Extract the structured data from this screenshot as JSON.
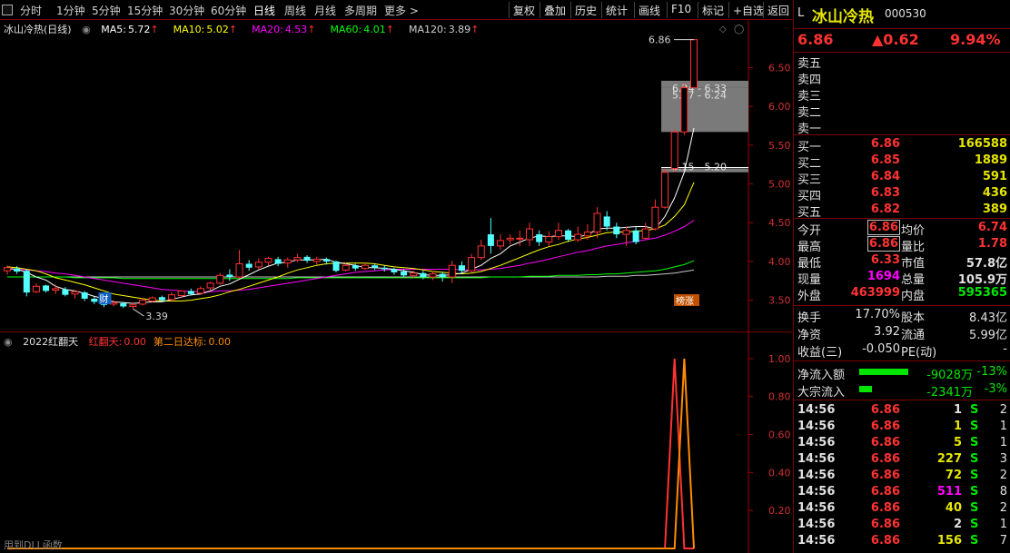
{
  "toolbar": {
    "periods": [
      "分时",
      "1分钟",
      "5分钟",
      "15分钟",
      "30分钟",
      "60分钟",
      "日线",
      "周线",
      "月线",
      "多周期",
      "更多 >"
    ],
    "active_period": "日线",
    "buttons": [
      "复权",
      "叠加",
      "历史",
      "统计",
      "画线",
      "F10",
      "标记",
      "+自选",
      "返回"
    ]
  },
  "main_chart": {
    "title": "冰山冷热(日线)",
    "ma": [
      {
        "label": "MA5:",
        "value": "5.72",
        "color": "#ffffff"
      },
      {
        "label": "MA10:",
        "value": "5.02",
        "color": "#ffff00"
      },
      {
        "label": "MA20:",
        "value": "4.53",
        "color": "#ff00ff"
      },
      {
        "label": "MA60:",
        "value": "4.01",
        "color": "#00ff00"
      },
      {
        "label": "MA120:",
        "value": "3.89",
        "color": "#d0d0d0"
      }
    ],
    "price_axis": [
      "6.50",
      "6.00",
      "5.50",
      "5.00",
      "4.50",
      "4.00",
      "3.50"
    ],
    "high_label": "6.86",
    "low_label": "3.39",
    "gaps": [
      {
        "label": "6.24 - 6.33",
        "low": 6.24,
        "high": 6.33
      },
      {
        "label": "5.67 - 6.24",
        "low": 5.67,
        "high": 6.24
      },
      {
        "label": "5.15 - 5.20",
        "low": 5.15,
        "high": 5.2
      }
    ],
    "markers": {
      "cai": "财",
      "bang": "榜涨"
    },
    "chart_data": {
      "type": "candlestick",
      "ylim": [
        3.25,
        6.95
      ],
      "candles": [
        [
          3.88,
          3.92,
          3.83,
          3.95
        ],
        [
          3.91,
          3.87,
          3.84,
          3.94
        ],
        [
          3.88,
          3.6,
          3.55,
          3.9
        ],
        [
          3.61,
          3.68,
          3.59,
          3.72
        ],
        [
          3.69,
          3.62,
          3.6,
          3.7
        ],
        [
          3.63,
          3.65,
          3.58,
          3.7
        ],
        [
          3.64,
          3.57,
          3.55,
          3.67
        ],
        [
          3.58,
          3.61,
          3.52,
          3.63
        ],
        [
          3.6,
          3.52,
          3.49,
          3.62
        ],
        [
          3.52,
          3.48,
          3.45,
          3.54
        ],
        [
          3.47,
          3.44,
          3.41,
          3.5
        ],
        [
          3.45,
          3.47,
          3.42,
          3.5
        ],
        [
          3.46,
          3.42,
          3.4,
          3.48
        ],
        [
          3.42,
          3.44,
          3.39,
          3.47
        ],
        [
          3.45,
          3.5,
          3.43,
          3.53
        ],
        [
          3.49,
          3.53,
          3.47,
          3.55
        ],
        [
          3.54,
          3.5,
          3.48,
          3.56
        ],
        [
          3.51,
          3.57,
          3.49,
          3.6
        ],
        [
          3.56,
          3.62,
          3.53,
          3.63
        ],
        [
          3.62,
          3.58,
          3.56,
          3.65
        ],
        [
          3.59,
          3.65,
          3.57,
          3.68
        ],
        [
          3.66,
          3.72,
          3.62,
          3.74
        ],
        [
          3.72,
          3.82,
          3.7,
          3.85
        ],
        [
          3.83,
          3.8,
          3.75,
          3.9
        ],
        [
          3.8,
          3.97,
          3.78,
          4.15
        ],
        [
          3.97,
          3.92,
          3.88,
          4.02
        ],
        [
          3.93,
          3.99,
          3.9,
          4.04
        ],
        [
          3.99,
          4.04,
          3.95,
          4.06
        ],
        [
          4.03,
          3.97,
          3.94,
          4.06
        ],
        [
          3.98,
          4.02,
          3.92,
          4.05
        ],
        [
          4.02,
          4.05,
          3.99,
          4.1
        ],
        [
          4.06,
          4.01,
          3.98,
          4.08
        ],
        [
          4.0,
          4.03,
          3.96,
          4.06
        ],
        [
          4.03,
          4.0,
          3.96,
          4.05
        ],
        [
          4.0,
          3.88,
          3.86,
          4.01
        ],
        [
          3.89,
          3.95,
          3.87,
          3.98
        ],
        [
          3.95,
          3.91,
          3.88,
          3.97
        ],
        [
          3.91,
          3.95,
          3.89,
          3.98
        ],
        [
          3.95,
          3.92,
          3.89,
          3.97
        ],
        [
          3.92,
          3.9,
          3.87,
          3.95
        ],
        [
          3.9,
          3.86,
          3.83,
          3.92
        ],
        [
          3.87,
          3.82,
          3.8,
          3.9
        ],
        [
          3.82,
          3.85,
          3.79,
          3.88
        ],
        [
          3.85,
          3.8,
          3.77,
          3.88
        ],
        [
          3.8,
          3.84,
          3.76,
          3.88
        ],
        [
          3.84,
          3.8,
          3.74,
          3.87
        ],
        [
          3.8,
          3.95,
          3.72,
          4.01
        ],
        [
          3.95,
          3.88,
          3.84,
          4.0
        ],
        [
          3.88,
          4.05,
          3.86,
          4.1
        ],
        [
          4.05,
          4.2,
          4.02,
          4.28
        ],
        [
          4.35,
          4.2,
          4.1,
          4.56
        ],
        [
          4.2,
          4.27,
          4.15,
          4.35
        ],
        [
          4.28,
          4.3,
          4.22,
          4.35
        ],
        [
          4.3,
          4.3,
          4.2,
          4.4
        ],
        [
          4.28,
          4.42,
          4.2,
          4.5
        ],
        [
          4.35,
          4.25,
          4.2,
          4.4
        ],
        [
          4.25,
          4.32,
          4.2,
          4.39
        ],
        [
          4.32,
          4.4,
          4.28,
          4.5
        ],
        [
          4.4,
          4.28,
          4.25,
          4.42
        ],
        [
          4.28,
          4.35,
          4.25,
          4.45
        ],
        [
          4.33,
          4.38,
          4.28,
          4.48
        ],
        [
          4.38,
          4.62,
          4.3,
          4.7
        ],
        [
          4.58,
          4.45,
          4.4,
          4.65
        ],
        [
          4.45,
          4.35,
          4.3,
          4.5
        ],
        [
          4.35,
          4.4,
          4.2,
          4.45
        ],
        [
          4.4,
          4.25,
          4.22,
          4.45
        ],
        [
          4.3,
          4.42,
          4.28,
          4.5
        ],
        [
          4.42,
          4.7,
          4.4,
          4.8
        ],
        [
          4.7,
          5.15,
          4.68,
          5.2
        ],
        [
          5.2,
          5.67,
          5.15,
          5.7
        ],
        [
          5.67,
          6.24,
          5.63,
          6.3
        ],
        [
          6.24,
          6.86,
          6.24,
          6.86
        ]
      ],
      "ma5": [
        3.91,
        3.9,
        3.86,
        3.8,
        3.76,
        3.68,
        3.64,
        3.62,
        3.59,
        3.55,
        3.52,
        3.48,
        3.47,
        3.46,
        3.47,
        3.48,
        3.48,
        3.51,
        3.54,
        3.57,
        3.58,
        3.62,
        3.68,
        3.71,
        3.77,
        3.83,
        3.89,
        3.94,
        3.98,
        3.99,
        4.02,
        4.02,
        4.02,
        4.03,
        3.99,
        3.97,
        3.95,
        3.92,
        3.92,
        3.91,
        3.9,
        3.88,
        3.86,
        3.83,
        3.82,
        3.82,
        3.83,
        3.85,
        3.9,
        3.95,
        4.04,
        4.1,
        4.2,
        4.25,
        4.3,
        4.33,
        4.32,
        4.33,
        4.33,
        4.32,
        4.34,
        4.42,
        4.43,
        4.43,
        4.44,
        4.45,
        4.45,
        4.42,
        4.58,
        4.82,
        5.15,
        5.72
      ],
      "ma10": [
        3.93,
        3.92,
        3.9,
        3.88,
        3.84,
        3.79,
        3.76,
        3.73,
        3.7,
        3.66,
        3.62,
        3.58,
        3.56,
        3.54,
        3.52,
        3.5,
        3.49,
        3.49,
        3.49,
        3.5,
        3.52,
        3.54,
        3.57,
        3.61,
        3.64,
        3.68,
        3.72,
        3.76,
        3.8,
        3.85,
        3.89,
        3.92,
        3.95,
        3.97,
        3.98,
        3.98,
        3.98,
        3.98,
        3.97,
        3.95,
        3.93,
        3.92,
        3.91,
        3.89,
        3.87,
        3.86,
        3.85,
        3.84,
        3.85,
        3.87,
        3.91,
        3.95,
        4.0,
        4.05,
        4.1,
        4.15,
        4.19,
        4.22,
        4.26,
        4.29,
        4.31,
        4.34,
        4.37,
        4.38,
        4.38,
        4.39,
        4.4,
        4.42,
        4.47,
        4.58,
        4.73,
        5.02
      ],
      "ma20": [
        3.9,
        3.9,
        3.89,
        3.88,
        3.87,
        3.85,
        3.84,
        3.82,
        3.8,
        3.78,
        3.76,
        3.74,
        3.72,
        3.7,
        3.68,
        3.66,
        3.64,
        3.63,
        3.62,
        3.61,
        3.61,
        3.61,
        3.62,
        3.62,
        3.63,
        3.64,
        3.66,
        3.68,
        3.7,
        3.72,
        3.74,
        3.76,
        3.78,
        3.8,
        3.82,
        3.84,
        3.86,
        3.87,
        3.88,
        3.89,
        3.9,
        3.9,
        3.9,
        3.9,
        3.9,
        3.9,
        3.9,
        3.89,
        3.89,
        3.89,
        3.9,
        3.91,
        3.93,
        3.95,
        3.98,
        4.0,
        4.03,
        4.06,
        4.09,
        4.12,
        4.14,
        4.17,
        4.2,
        4.22,
        4.24,
        4.26,
        4.28,
        4.3,
        4.34,
        4.39,
        4.45,
        4.53
      ],
      "ma60": [
        3.8,
        3.8,
        3.8,
        3.8,
        3.8,
        3.8,
        3.8,
        3.79,
        3.79,
        3.79,
        3.79,
        3.79,
        3.78,
        3.78,
        3.78,
        3.78,
        3.78,
        3.78,
        3.78,
        3.78,
        3.78,
        3.78,
        3.78,
        3.78,
        3.78,
        3.78,
        3.78,
        3.78,
        3.78,
        3.78,
        3.79,
        3.79,
        3.79,
        3.79,
        3.79,
        3.79,
        3.79,
        3.79,
        3.79,
        3.79,
        3.79,
        3.79,
        3.79,
        3.79,
        3.79,
        3.79,
        3.79,
        3.79,
        3.79,
        3.79,
        3.8,
        3.8,
        3.8,
        3.8,
        3.81,
        3.81,
        3.81,
        3.82,
        3.82,
        3.82,
        3.83,
        3.83,
        3.84,
        3.84,
        3.85,
        3.86,
        3.87,
        3.88,
        3.9,
        3.93,
        3.96,
        4.01
      ],
      "ma120": [
        3.8,
        3.8,
        3.8,
        3.8,
        3.8,
        3.8,
        3.8,
        3.8,
        3.8,
        3.8,
        3.8,
        3.8,
        3.8,
        3.8,
        3.8,
        3.8,
        3.8,
        3.8,
        3.8,
        3.8,
        3.8,
        3.8,
        3.8,
        3.8,
        3.8,
        3.8,
        3.8,
        3.8,
        3.8,
        3.8,
        3.8,
        3.8,
        3.8,
        3.8,
        3.8,
        3.8,
        3.8,
        3.8,
        3.8,
        3.8,
        3.8,
        3.8,
        3.8,
        3.8,
        3.8,
        3.8,
        3.8,
        3.8,
        3.8,
        3.8,
        3.8,
        3.8,
        3.8,
        3.8,
        3.8,
        3.8,
        3.8,
        3.8,
        3.8,
        3.8,
        3.8,
        3.8,
        3.81,
        3.81,
        3.81,
        3.82,
        3.82,
        3.83,
        3.84,
        3.85,
        3.87,
        3.89
      ]
    }
  },
  "sub_chart": {
    "title": "2022红翻天",
    "series": [
      {
        "label": "红翻天:",
        "value": "0.00",
        "color": "#ff3232"
      },
      {
        "label": "第二日达标:",
        "value": "0.00",
        "color": "#ff8c00"
      }
    ],
    "y_axis": [
      "1.00",
      "0.80",
      "0.60",
      "0.40",
      "0.20"
    ],
    "footer": "用到DLL函数",
    "chart_data": {
      "type": "line",
      "ylim": [
        0,
        1.1
      ],
      "red_spike_index": 69,
      "orange_spike_index": 70
    }
  },
  "quote": {
    "prefix": "L",
    "name": "冰山冷热",
    "code": "000530",
    "price": "6.86",
    "change": "▲0.62",
    "pct": "9.94%",
    "sell": [
      {
        "label": "卖五",
        "price": "",
        "vol": ""
      },
      {
        "label": "卖四",
        "price": "",
        "vol": ""
      },
      {
        "label": "卖三",
        "price": "",
        "vol": ""
      },
      {
        "label": "卖二",
        "price": "",
        "vol": ""
      },
      {
        "label": "卖一",
        "price": "",
        "vol": ""
      }
    ],
    "buy": [
      {
        "label": "买一",
        "price": "6.86",
        "vol": "166588"
      },
      {
        "label": "买二",
        "price": "6.85",
        "vol": "1889"
      },
      {
        "label": "买三",
        "price": "6.84",
        "vol": "591"
      },
      {
        "label": "买四",
        "price": "6.83",
        "vol": "436"
      },
      {
        "label": "买五",
        "price": "6.82",
        "vol": "389"
      }
    ],
    "stats": [
      {
        "l1": "今开",
        "v1": "6.86",
        "c1": "red",
        "boxed": true,
        "l2": "均价",
        "v2": "6.74",
        "c2": "red"
      },
      {
        "l1": "最高",
        "v1": "6.86",
        "c1": "red",
        "boxed": true,
        "l2": "量比",
        "v2": "1.78",
        "c2": "red"
      },
      {
        "l1": "最低",
        "v1": "6.33",
        "c1": "red",
        "boxed": false,
        "l2": "市值",
        "v2": "57.8亿",
        "c2": "white"
      },
      {
        "l1": "现量",
        "v1": "1694",
        "c1": "magenta",
        "boxed": false,
        "l2": "总量",
        "v2": "105.9万",
        "c2": "white"
      },
      {
        "l1": "外盘",
        "v1": "463999",
        "c1": "red",
        "boxed": false,
        "l2": "内盘",
        "v2": "595365",
        "c2": "green"
      }
    ],
    "stats2": [
      {
        "l1": "换手",
        "v1": "17.70%",
        "l2": "股本",
        "v2": "8.43亿"
      },
      {
        "l1": "净资",
        "v1": "3.92",
        "l2": "流通",
        "v2": "5.99亿"
      },
      {
        "l1": "收益(三)",
        "v1": "-0.050",
        "l2": "PE(动)",
        "v2": "-"
      }
    ],
    "flows": [
      {
        "label": "净流入额",
        "bar_fraction": 1.0,
        "value": "-9028万",
        "pct": "-13%"
      },
      {
        "label": "大宗流入",
        "bar_fraction": 0.26,
        "value": "-2341万",
        "pct": "-3%"
      }
    ],
    "ticks": [
      {
        "time": "14:56",
        "price": "6.86",
        "vol": "1",
        "vc": "white",
        "side": "S",
        "n": "2"
      },
      {
        "time": "14:56",
        "price": "6.86",
        "vol": "1",
        "vc": "yellow",
        "side": "S",
        "n": "1"
      },
      {
        "time": "14:56",
        "price": "6.86",
        "vol": "5",
        "vc": "yellow",
        "side": "S",
        "n": "1"
      },
      {
        "time": "14:56",
        "price": "6.86",
        "vol": "227",
        "vc": "yellow",
        "side": "S",
        "n": "3"
      },
      {
        "time": "14:56",
        "price": "6.86",
        "vol": "72",
        "vc": "yellow",
        "side": "S",
        "n": "2"
      },
      {
        "time": "14:56",
        "price": "6.86",
        "vol": "511",
        "vc": "magenta",
        "side": "S",
        "n": "8"
      },
      {
        "time": "14:56",
        "price": "6.86",
        "vol": "40",
        "vc": "yellow",
        "side": "S",
        "n": "2"
      },
      {
        "time": "14:56",
        "price": "6.86",
        "vol": "2",
        "vc": "white",
        "side": "S",
        "n": "1"
      },
      {
        "time": "14:56",
        "price": "6.86",
        "vol": "156",
        "vc": "yellow",
        "side": "S",
        "n": "7"
      }
    ]
  }
}
